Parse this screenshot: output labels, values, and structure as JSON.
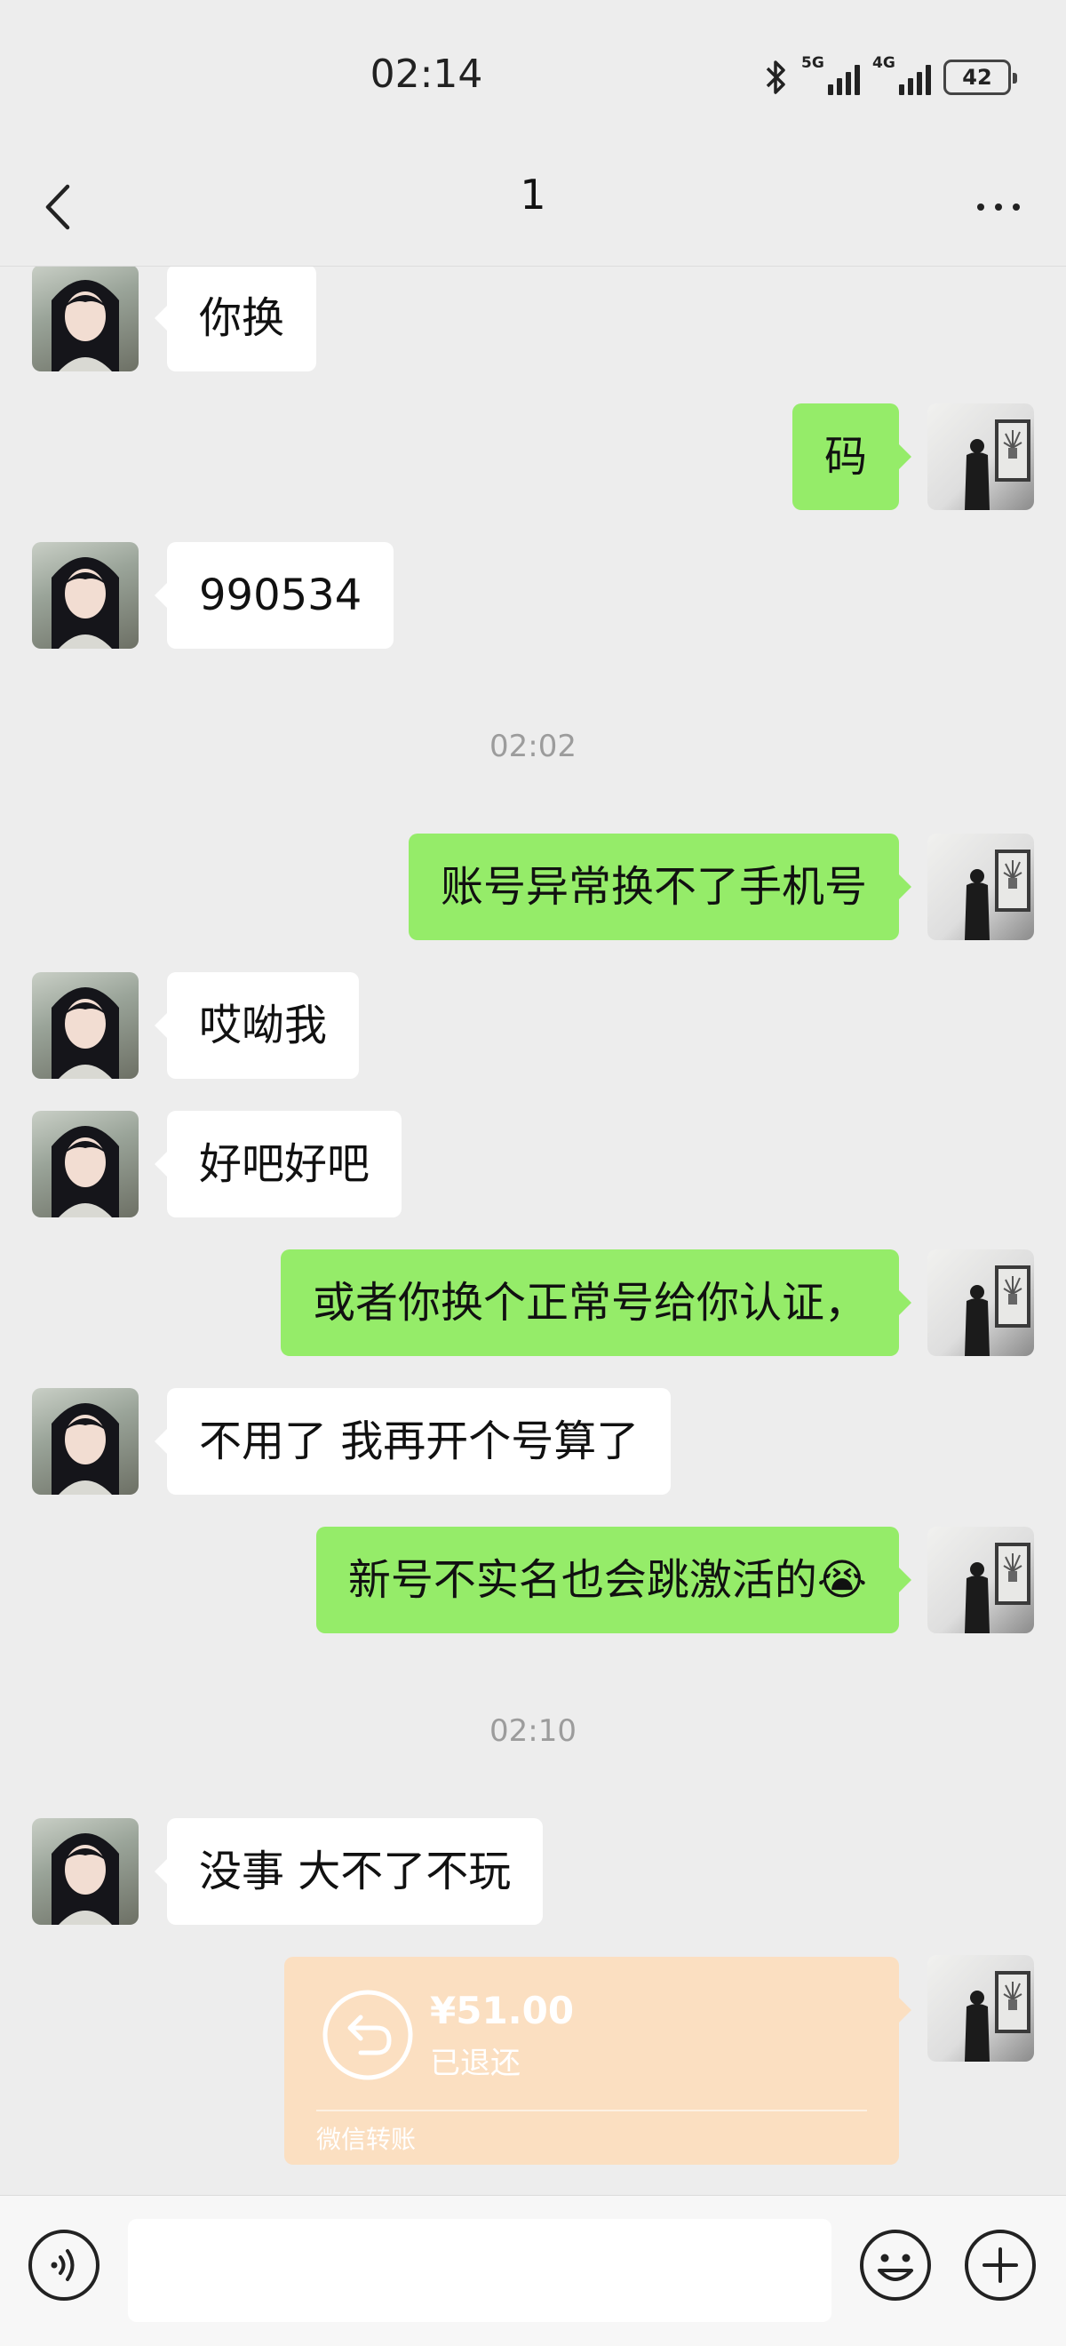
{
  "status_bar": {
    "time": "02:14",
    "network_1": "5G",
    "network_2": "4G",
    "battery": "42"
  },
  "header": {
    "title": "1",
    "back_icon": "chevron-left-icon",
    "more_icon": "more-dots-icon"
  },
  "messages": [
    {
      "side": "left",
      "text": "你换"
    },
    {
      "side": "right",
      "text": "码"
    },
    {
      "side": "left",
      "text": "990534"
    },
    {
      "side": "right",
      "text": "账号异常换不了手机号"
    },
    {
      "side": "left",
      "text": "哎呦我"
    },
    {
      "side": "left",
      "text": "好吧好吧"
    },
    {
      "side": "right",
      "text": "或者你换个正常号给你认证，"
    },
    {
      "side": "left",
      "text": "不用了 我再开个号算了"
    },
    {
      "side": "right",
      "text": "新号不实名也会跳激活的😭"
    },
    {
      "side": "left",
      "text": "没事 大不了不玩"
    }
  ],
  "timestamps": [
    "02:02",
    "02:10"
  ],
  "transfer": {
    "amount": "¥51.00",
    "status": "已退还",
    "label": "微信转账",
    "icon": "return-arrow-icon"
  },
  "input_bar": {
    "placeholder": "",
    "voice_icon": "voice-icon",
    "emoji_icon": "emoji-icon",
    "plus_icon": "plus-icon"
  },
  "colors": {
    "background": "#ededed",
    "sent_bubble": "#95ec69",
    "received_bubble": "#ffffff",
    "transfer_card": "#fbdfc1",
    "timestamp_text": "#9c9c9c"
  }
}
